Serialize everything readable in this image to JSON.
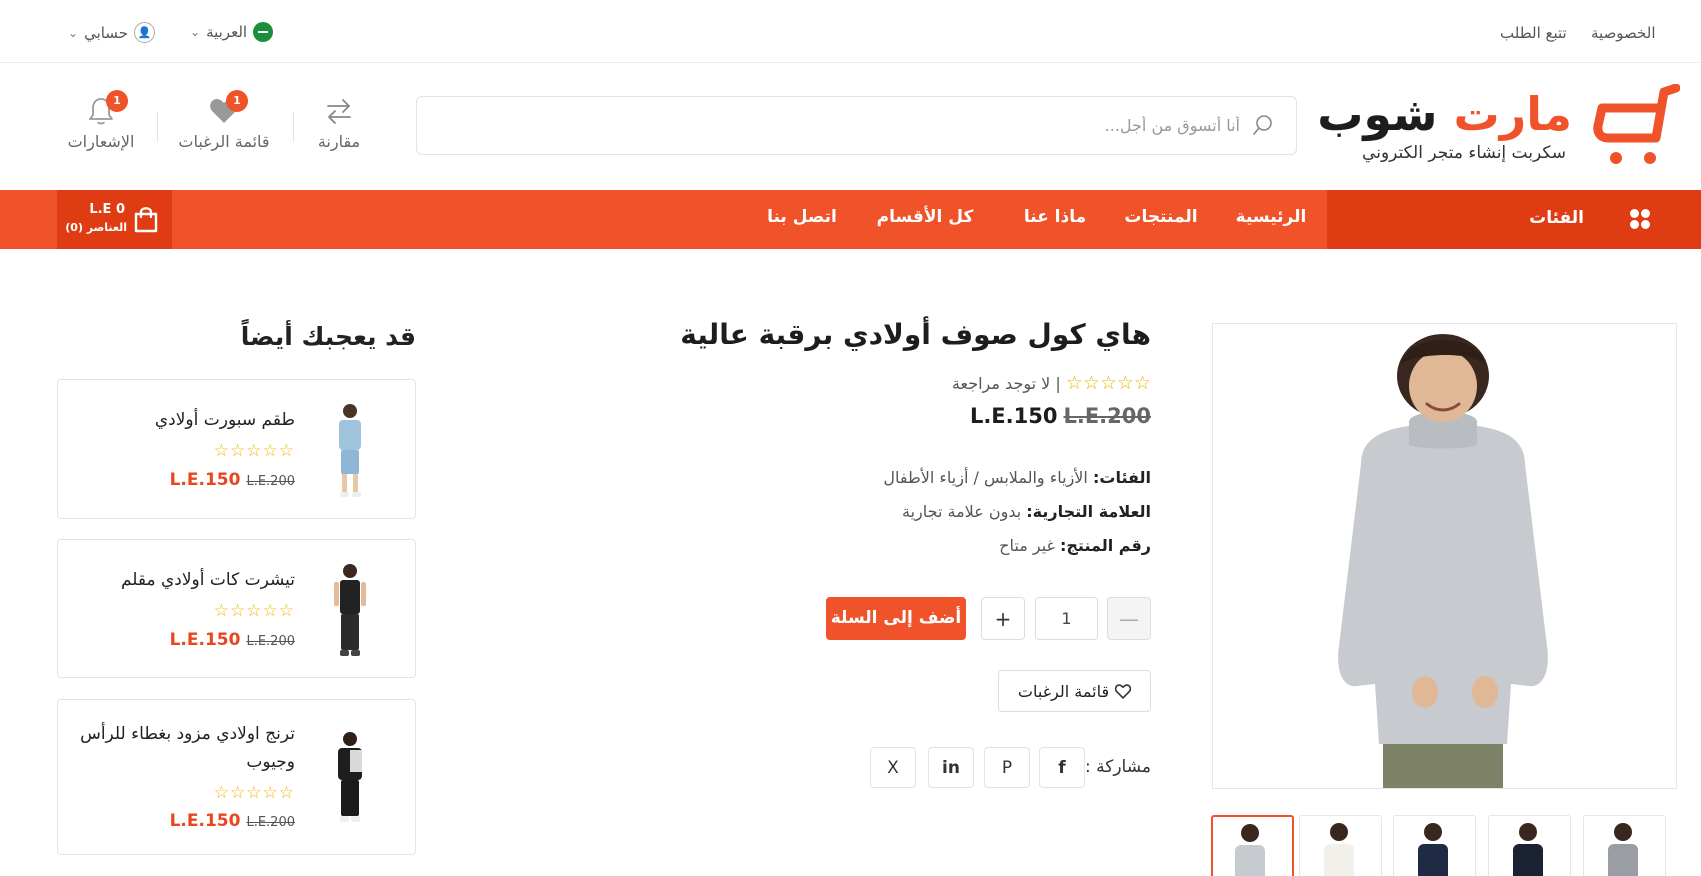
{
  "topbar": {
    "privacy": "الخصوصية",
    "track_order": "تتبع الطلب",
    "language": "العربية",
    "account": "حسابي"
  },
  "brand": {
    "name_part1": "شوب",
    "name_part2": "مارت",
    "tagline": "سكربت إنشاء متجر الكتروني",
    "accent_color": "#f0532a"
  },
  "search": {
    "placeholder": "أنا أتسوق من أجل..."
  },
  "header_icons": {
    "compare": "مقارنة",
    "wishlist": "قائمة الرغبات",
    "wishlist_count": "1",
    "notifications": "الإشعارات",
    "notifications_count": "1"
  },
  "nav": {
    "categories": "الفئات",
    "items": [
      "الرئيسية",
      "المنتجات",
      "ماذا عنا",
      "كل الأقسام",
      "اتصل بنا"
    ],
    "cart_amount": "0 L.E",
    "cart_items": "العناصر (0)"
  },
  "sidebar": {
    "title": "قد يعجبك أيضاً",
    "products": [
      {
        "name": "طقم سبورت أولادي",
        "stars": "☆☆☆☆☆",
        "old_price": "L.E.200",
        "price": "L.E.150"
      },
      {
        "name": "تيشرت كات أولادي مقلم",
        "stars": "☆☆☆☆☆",
        "old_price": "L.E.200",
        "price": "L.E.150"
      },
      {
        "name": "ترنج اولادي مزود بغطاء للرأس وجيوب",
        "stars": "☆☆☆☆☆",
        "old_price": "L.E.200",
        "price": "L.E.150"
      }
    ]
  },
  "product": {
    "title": "هاي كول صوف أولادي برقبة عالية",
    "stars": "☆☆☆☆☆",
    "review_text": "| لا توجد مراجعة",
    "old_price": "L.E.200",
    "price": "L.E.150",
    "category_label": "الفئات:",
    "category_value": "الأزياء والملابس / أزياء الأطفال",
    "brand_label": "العلامة التجارية:",
    "brand_value": "بدون علامة تجارية",
    "sku_label": "رقم المنتج:",
    "sku_value": "غير متاح",
    "quantity": "1",
    "minus": "—",
    "plus": "+",
    "add_to_cart": "أضف إلى السلة",
    "wishlist": "قائمة الرغبات",
    "share_label": "مشاركة :",
    "social": [
      "f",
      "P",
      "in",
      "X"
    ]
  }
}
